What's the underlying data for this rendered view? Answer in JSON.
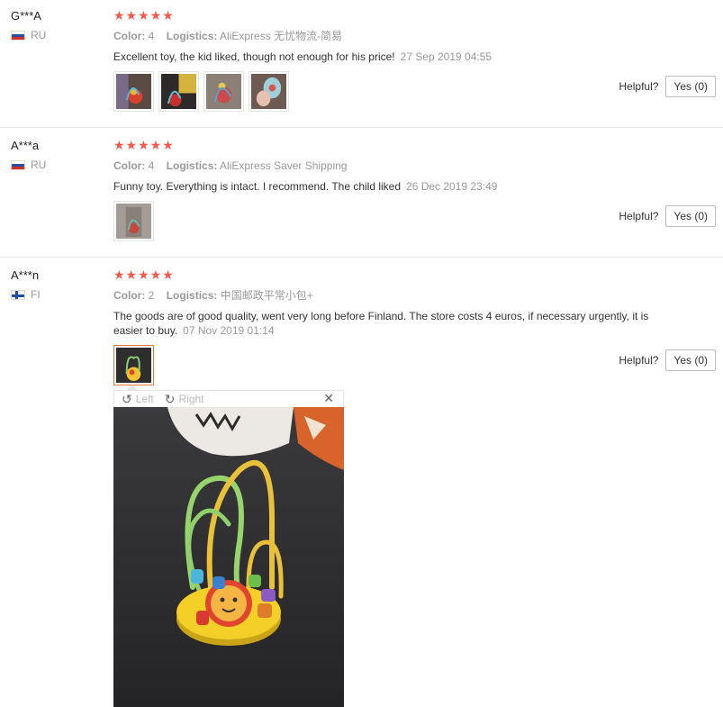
{
  "reviews": [
    {
      "user": "G***A",
      "country": "RU",
      "stars": "★★★★★",
      "color_label": "Color:",
      "color_value": "4",
      "logistics_label": "Logistics:",
      "logistics_value": "AliExpress 无忧物流-简易",
      "text": "Excellent toy, the kid liked, though not enough for his price!",
      "date": "27 Sep 2019 04:55",
      "helpful_label": "Helpful?",
      "yes_label": "Yes (0)"
    },
    {
      "user": "A***a",
      "country": "RU",
      "stars": "★★★★★",
      "color_label": "Color:",
      "color_value": "4",
      "logistics_label": "Logistics:",
      "logistics_value": "AliExpress Saver Shipping",
      "text": "Funny toy. Everything is intact. I recommend. The child liked",
      "date": "26 Dec 2019 23:49",
      "helpful_label": "Helpful?",
      "yes_label": "Yes (0)"
    },
    {
      "user": "A***n",
      "country": "FI",
      "stars": "★★★★★",
      "color_label": "Color:",
      "color_value": "2",
      "logistics_label": "Logistics:",
      "logistics_value": "中国邮政平常小包+",
      "text": "The goods are of good quality, went very long before Finland. The store costs 4 euros, if necessary urgently, it is easier to buy.",
      "date": "07 Nov 2019 01:14",
      "helpful_label": "Helpful?",
      "yes_label": "Yes (0)"
    }
  ],
  "viewer": {
    "left_label": "Left",
    "right_label": "Right",
    "close_glyph": "✕",
    "rotate_left_glyph": "↺",
    "rotate_right_glyph": "↻"
  },
  "colors": {
    "star": "#f45a4b",
    "active_thumb_border": "#e47a3c"
  }
}
